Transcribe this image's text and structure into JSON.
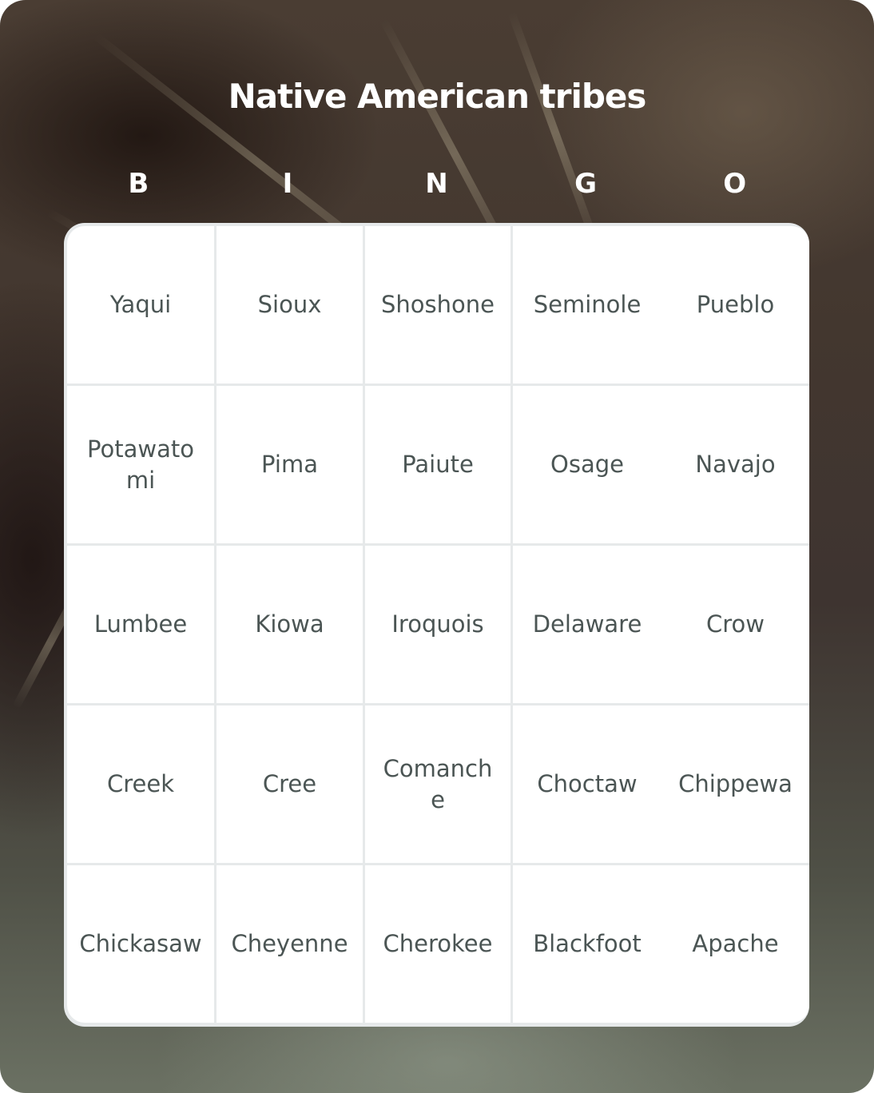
{
  "title": "Native American tribes",
  "header_letters": [
    "B",
    "I",
    "N",
    "G",
    "O"
  ],
  "colors": {
    "title_text": "#ffffff",
    "cell_background": "#ffffff",
    "cell_text": "#4b5554",
    "grid_border": "#e6e9ea"
  },
  "grid": [
    [
      "Yaqui",
      "Sioux",
      "Shoshone",
      "Seminole",
      "Pueblo"
    ],
    [
      "Potawatomi",
      "Pima",
      "Paiute",
      "Osage",
      "Navajo"
    ],
    [
      "Lumbee",
      "Kiowa",
      "Iroquois",
      "Delaware",
      "Crow"
    ],
    [
      "Creek",
      "Cree",
      "Comanche",
      "Choctaw",
      "Chippewa"
    ],
    [
      "Chickasaw",
      "Cheyenne",
      "Cherokee",
      "Blackfoot",
      "Apache"
    ]
  ]
}
